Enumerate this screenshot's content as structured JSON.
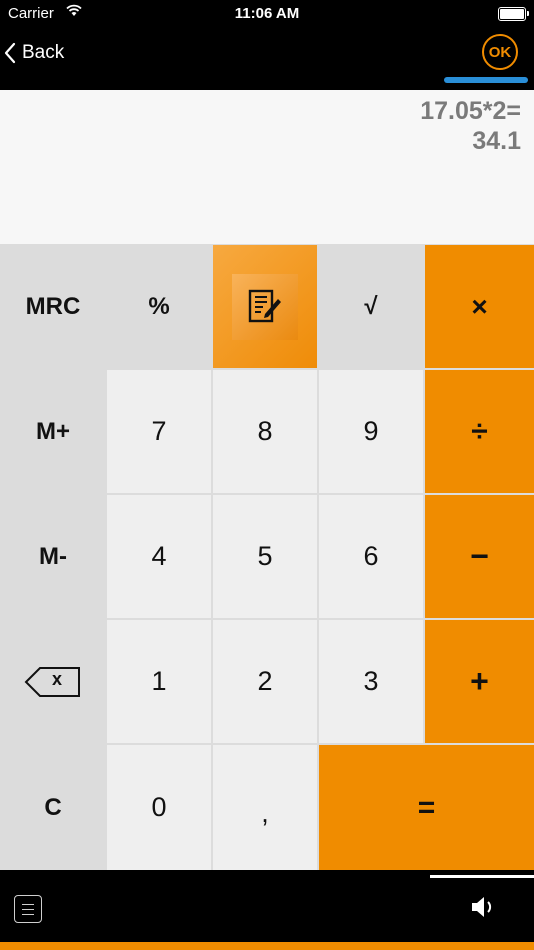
{
  "status_bar": {
    "carrier": "Carrier",
    "time": "11:06 AM"
  },
  "nav": {
    "back_label": "Back",
    "ok_label": "OK"
  },
  "display": {
    "expression": "17.05*2=",
    "result": "34.1"
  },
  "keys": {
    "mrc": "MRC",
    "percent": "%",
    "sqrt": "√",
    "multiply": "×",
    "mplus": "M+",
    "seven": "7",
    "eight": "8",
    "nine": "9",
    "divide": "÷",
    "mminus": "M-",
    "four": "4",
    "five": "5",
    "six": "6",
    "minus": "−",
    "backspace_x": "x",
    "one": "1",
    "two": "2",
    "three": "3",
    "plus": "+",
    "clear": "C",
    "zero": "0",
    "comma": ",",
    "equals": "="
  },
  "colors": {
    "accent": "#f08c00",
    "key_gray": "#dcdcdc",
    "key_light": "#efefef",
    "ok_bar": "#2a8fd8"
  },
  "icons": [
    "wifi-icon",
    "battery-icon",
    "back-chevron-icon",
    "notes-icon",
    "backspace-icon",
    "menu-icon",
    "speaker-icon"
  ]
}
